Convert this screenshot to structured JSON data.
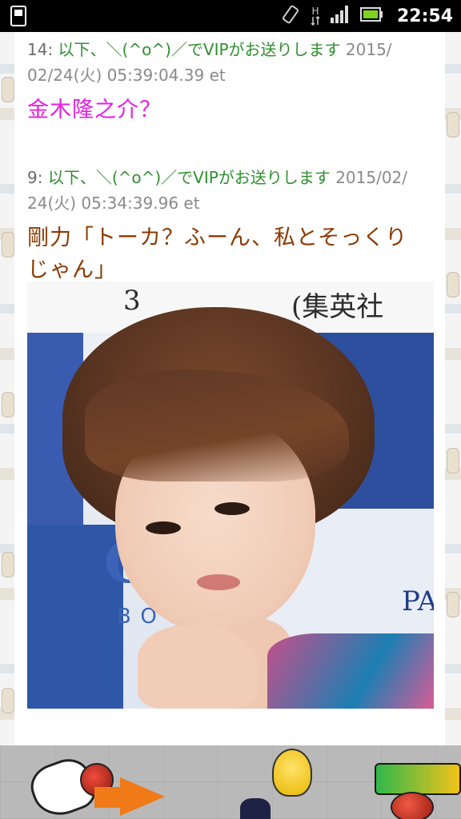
{
  "statusbar": {
    "network_label": "H",
    "time": "22:54"
  },
  "posts": [
    {
      "number": "14:",
      "name": "以下、＼(^o^)／でVIPがお送りします",
      "date_line1": "2015/",
      "date_line2": "02/24(火) 05:39:04.39 et",
      "body_lines": [
        "金木隆之介？"
      ]
    },
    {
      "number": "9:",
      "name": "以下、＼(^o^)／でVIPがお送りします",
      "date_line1": "2015/02/",
      "date_line2": "24(火) 05:34:39.96 et",
      "body_lines": [
        "剛力「トーカ？ふーん、私とそっくり",
        "じゃん」"
      ]
    }
  ],
  "photo": {
    "backdrop_text_left": "3",
    "backdrop_text_right": "(集英社",
    "brand_big": "CLIE",
    "brand_small": "BOOK",
    "brand_right": "PA"
  },
  "colors": {
    "name_green": "#2f8f2f",
    "post1_body": "#e61ee6",
    "post2_body": "#8b3a00",
    "meta_gray": "#8a8a8a"
  }
}
